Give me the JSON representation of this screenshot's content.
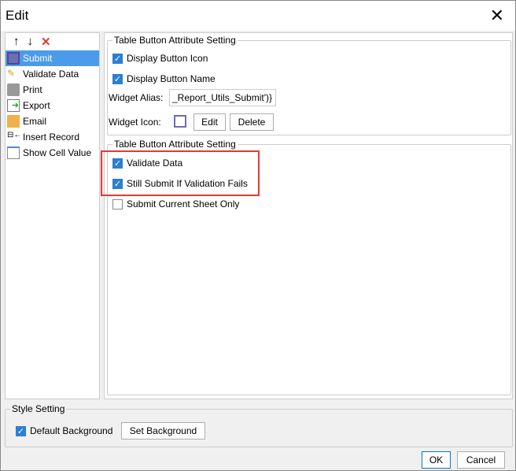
{
  "title": "Edit",
  "toolbar": {
    "up": "↑",
    "down": "↓",
    "delete": "✕"
  },
  "items": [
    {
      "label": "Submit",
      "icon": "save-icon"
    },
    {
      "label": "Validate Data",
      "icon": "pencil-icon"
    },
    {
      "label": "Print",
      "icon": "printer-icon"
    },
    {
      "label": "Export",
      "icon": "export-icon"
    },
    {
      "label": "Email",
      "icon": "email-icon"
    },
    {
      "label": "Insert Record",
      "icon": "insert-record-icon"
    },
    {
      "label": "Show Cell Value",
      "icon": "cell-icon"
    }
  ],
  "group1": {
    "legend": "Table Button Attribute Setting",
    "display_icon": "Display Button Icon",
    "display_name": "Display Button Name",
    "alias_label": "Widget Alias:",
    "alias_value": "_Report_Utils_Submit')}",
    "icon_label": "Widget Icon:",
    "edit": "Edit",
    "delete": "Delete"
  },
  "group2": {
    "legend": "Table Button Attribute Setting",
    "validate": "Validate Data",
    "still_submit": "Still Submit If Validation Fails",
    "current_sheet": "Submit Current Sheet Only"
  },
  "style": {
    "legend": "Style Setting",
    "default_bg": "Default Background",
    "set_bg": "Set Background"
  },
  "footer": {
    "ok": "OK",
    "cancel": "Cancel"
  }
}
